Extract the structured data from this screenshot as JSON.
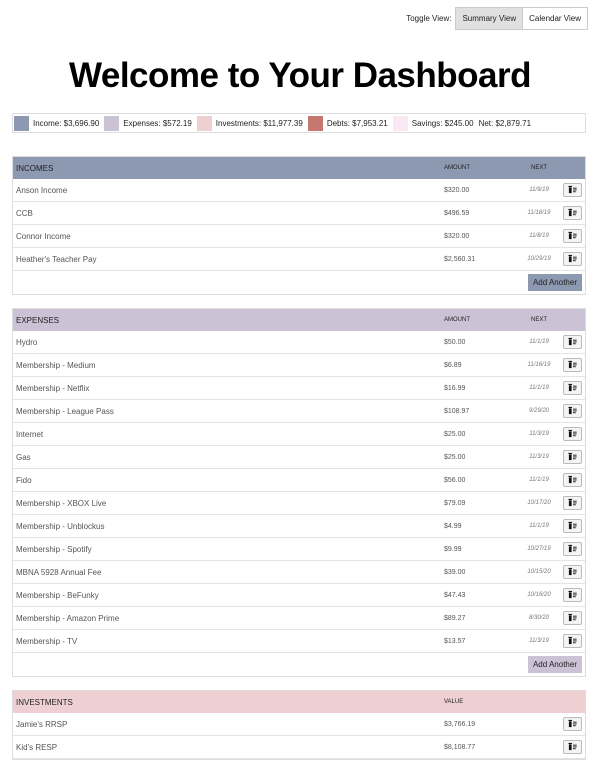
{
  "toggle": {
    "label": "Toggle View:",
    "summary": "Summary View",
    "calendar": "Calendar View"
  },
  "title": "Welcome to Your Dashboard",
  "legend": [
    {
      "text": "Income: $3,696.90",
      "color": "#8c99b0"
    },
    {
      "text": "Expenses: $572.19",
      "color": "#cbc2d6"
    },
    {
      "text": "Investments: $11,977.39",
      "color": "#efd0d2"
    },
    {
      "text": "Debts: $7,953.21",
      "color": "#c6776f"
    },
    {
      "text": "Savings: $245.00",
      "color": "#fae8f5"
    },
    {
      "text": "Net: $2,879.71",
      "color": null
    }
  ],
  "incomes": {
    "title": "INCOMES",
    "amount_header": "AMOUNT",
    "next_header": "NEXT",
    "color": "#8c99b0",
    "add_label": "Add Another",
    "rows": [
      {
        "name": "Anson Income",
        "amount": "$320.00",
        "next": "11/9/19"
      },
      {
        "name": "CCB",
        "amount": "$496.59",
        "next": "11/18/19"
      },
      {
        "name": "Connor Income",
        "amount": "$320.00",
        "next": "11/8/19"
      },
      {
        "name": "Heather's Teacher Pay",
        "amount": "$2,560.31",
        "next": "10/29/19"
      }
    ]
  },
  "expenses": {
    "title": "EXPENSES",
    "amount_header": "AMOUNT",
    "next_header": "NEXT",
    "color": "#cbc2d6",
    "add_label": "Add Another",
    "rows": [
      {
        "name": "Hydro",
        "amount": "$50.00",
        "next": "11/1/19"
      },
      {
        "name": "Membership - Medium",
        "amount": "$6.89",
        "next": "11/16/19"
      },
      {
        "name": "Membership - Netflix",
        "amount": "$16.99",
        "next": "11/1/19"
      },
      {
        "name": "Membership - League Pass",
        "amount": "$108.97",
        "next": "9/29/20"
      },
      {
        "name": "Internet",
        "amount": "$25.00",
        "next": "11/3/19"
      },
      {
        "name": "Gas",
        "amount": "$25.00",
        "next": "11/3/19"
      },
      {
        "name": "Fido",
        "amount": "$56.00",
        "next": "11/1/19"
      },
      {
        "name": "Membership - XBOX Live",
        "amount": "$79.09",
        "next": "10/17/20"
      },
      {
        "name": "Membership - Unblockus",
        "amount": "$4.99",
        "next": "11/1/19"
      },
      {
        "name": "Membership - Spotify",
        "amount": "$9.99",
        "next": "10/27/19"
      },
      {
        "name": "MBNA 5928 Annual Fee",
        "amount": "$39.00",
        "next": "10/15/20"
      },
      {
        "name": "Membership - BeFunky",
        "amount": "$47.43",
        "next": "10/16/20"
      },
      {
        "name": "Membership - Amazon Prime",
        "amount": "$89.27",
        "next": "8/30/20"
      },
      {
        "name": "Membership - TV",
        "amount": "$13.57",
        "next": "11/3/19"
      }
    ]
  },
  "investments": {
    "title": "INVESTMENTS",
    "value_header": "VALUE",
    "color": "#efd0d2",
    "rows": [
      {
        "name": "Jamie's RRSP",
        "amount": "$3,766.19"
      },
      {
        "name": "Kid's RESP",
        "amount": "$8,108.77"
      }
    ]
  }
}
